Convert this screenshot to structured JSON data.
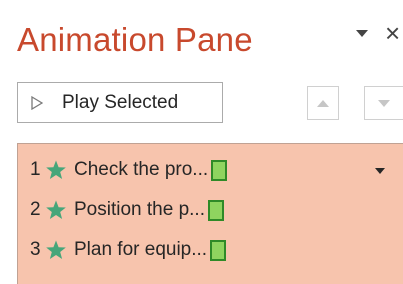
{
  "pane": {
    "title": "Animation Pane",
    "close_glyph": "×"
  },
  "toolbar": {
    "play_label": "Play Selected"
  },
  "animations": [
    {
      "order": "1",
      "label": "Check the pro..."
    },
    {
      "order": "2",
      "label": "Position the p..."
    },
    {
      "order": "3",
      "label": "Plan for equip..."
    }
  ],
  "colors": {
    "accent": "#c8492d",
    "selection_bg": "#f7c4ad",
    "effect_star": "#46a67a",
    "timing_bar": "#8fd45f"
  },
  "icons": {
    "pane_options": "chevron-down-icon",
    "close": "close-icon",
    "play": "play-icon",
    "move_up": "arrow-up-icon",
    "move_down": "arrow-down-icon",
    "effect": "star-icon",
    "item_menu": "chevron-down-icon"
  }
}
